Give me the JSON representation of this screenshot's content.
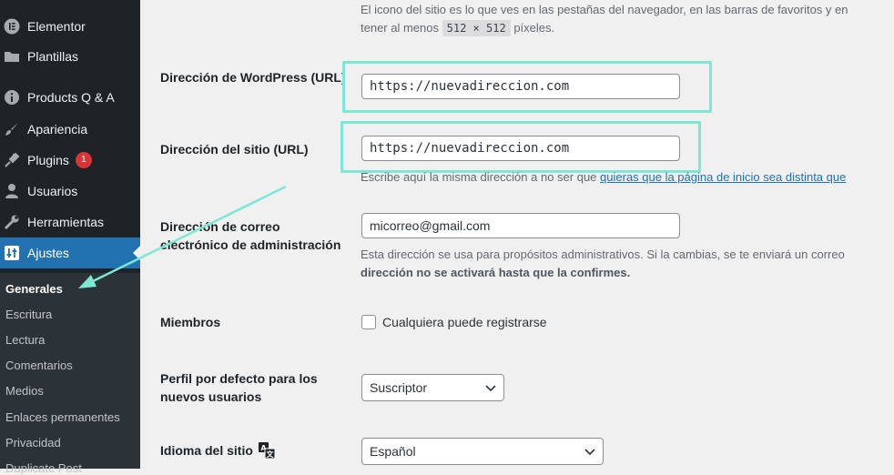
{
  "sidebar": {
    "items": [
      {
        "label": "Elementor",
        "icon": "elementor-icon"
      },
      {
        "label": "Plantillas",
        "icon": "folder-icon"
      },
      {
        "label": "Products Q & A",
        "icon": "info-icon"
      },
      {
        "label": "Apariencia",
        "icon": "brush-icon"
      },
      {
        "label": "Plugins",
        "icon": "plugin-icon",
        "badge": "1"
      },
      {
        "label": "Usuarios",
        "icon": "user-icon"
      },
      {
        "label": "Herramientas",
        "icon": "wrench-icon"
      },
      {
        "label": "Ajustes",
        "icon": "settings-icon"
      }
    ],
    "submenu": [
      "Generales",
      "Escritura",
      "Lectura",
      "Comentarios",
      "Medios",
      "Enlaces permanentes",
      "Privacidad",
      "Duplicate Post"
    ]
  },
  "content": {
    "site_icon_desc_line1": "El icono del sitio es lo que ves en las pestañas del navegador, en las barras de favoritos y en",
    "site_icon_desc_prefix": "tener al menos",
    "site_icon_size_a": "512",
    "site_icon_size_x": "×",
    "site_icon_size_b": "512",
    "site_icon_desc_suffix": "píxeles.",
    "wp_url_label": "Dirección de WordPress (URL)",
    "wp_url_value": "https://nuevadireccion.com",
    "site_url_label": "Dirección del sitio (URL)",
    "site_url_value": "https://nuevadireccion.com",
    "site_url_desc_prefix": "Escribe aquí la misma dirección a no ser que",
    "site_url_desc_link": "quieras que la página de inicio sea distinta que",
    "email_label": "Dirección de correo electrónico de administración",
    "email_value": "micorreo@gmail.com",
    "email_desc_line1": "Esta dirección se usa para propósitos administrativos. Si la cambias, se te enviará un correo",
    "email_desc_line2": "dirección no se activará hasta que la confirmes.",
    "members_label": "Miembros",
    "members_checkbox_label": "Cualquiera puede registrarse",
    "default_role_label": "Perfil por defecto para los nuevos usuarios",
    "default_role_value": "Suscriptor",
    "site_language_label": "Idioma del sitio",
    "site_language_value": "Español"
  },
  "colors": {
    "sidebar_bg": "#1d2327",
    "active_bg": "#2271b1",
    "highlight": "#7ce8d3",
    "badge": "#d63638"
  }
}
